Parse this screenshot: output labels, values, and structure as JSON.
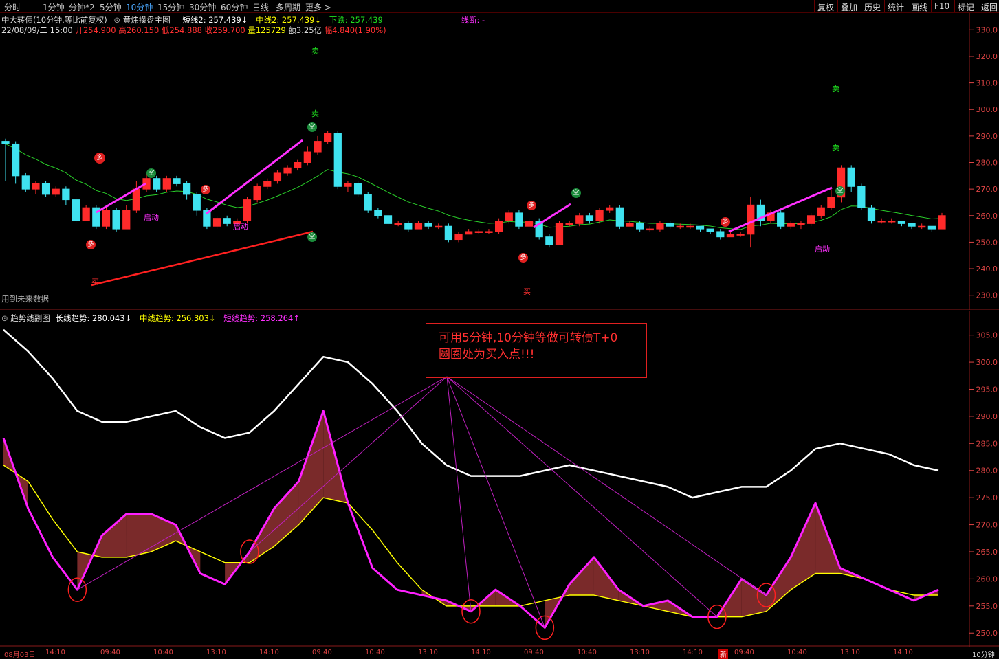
{
  "toolbar": {
    "periods": [
      "分时",
      "1分钟",
      "分钟*2",
      "5分钟",
      "10分钟",
      "15分钟",
      "30分钟",
      "60分钟",
      "日线",
      "多周期",
      "更多 >"
    ],
    "active_period": "10分钟",
    "right_buttons": [
      "复权",
      "叠加",
      "历史",
      "统计",
      "画线",
      "F10",
      "标记",
      "返回"
    ]
  },
  "main_panel": {
    "security": "中大转债(10分钟,等比前复权)",
    "indicator_name": "黄炜操盘主图",
    "short_line": "短线2: 257.439↓",
    "mid_line": "中线2: 257.439↓",
    "down_label": "下跌: 257.439",
    "line_break": "线断: -",
    "date": "22/08/09/二 15:00",
    "open": "开254.900",
    "high": "高260.150",
    "low": "低254.888",
    "close": "收259.700",
    "volume": "量125729",
    "amount": "额3.25亿",
    "range": "幅4.840(1.90%)",
    "future_data_note": "用到未来数据",
    "signals": {
      "sell": "卖",
      "buy": "买",
      "start": "启动",
      "empty": "空",
      "many": "多"
    }
  },
  "sub_panel": {
    "indicator_name": "趋势线副图",
    "long_trend": "长线趋势: 280.043↓",
    "mid_trend": "中线趋势: 256.303↓",
    "short_trend": "短线趋势: 258.264↑"
  },
  "annotation": {
    "line1": "可用5分钟,10分钟等做可转债T+0",
    "line2": "圆圈处为买入点!!!"
  },
  "x_axis": {
    "labels": [
      "08月03日",
      "14:10",
      "09:40",
      "10:40",
      "13:10",
      "14:10",
      "09:40",
      "10:40",
      "13:10",
      "14:10",
      "09:40",
      "10:40",
      "13:10",
      "14:10",
      "09:40",
      "10:40",
      "13:10",
      "14:10"
    ],
    "right_label": "10分钟",
    "new_badge": "新"
  },
  "colors": {
    "up": "#ff2a2a",
    "down": "#3fe2f0",
    "long_trend": "#ffffff",
    "mid_trend": "#ffff00",
    "short_trend": "#ff20ff",
    "axis": "#d44444"
  },
  "chart_data": [
    {
      "type": "candlestick",
      "title": "黄炜操盘主图",
      "ylim": [
        225,
        335
      ],
      "y_ticks": [
        230.0,
        240.0,
        250.0,
        260.0,
        270.0,
        280.0,
        290.0,
        300.0,
        310.0,
        320.0,
        330.0
      ],
      "candles": [
        [
          288,
          287,
          289,
          273
        ],
        [
          287,
          275,
          288,
          272
        ],
        [
          275,
          270,
          276,
          269
        ],
        [
          270,
          272,
          273,
          268
        ],
        [
          272,
          268,
          273,
          267
        ],
        [
          268,
          270,
          271,
          267
        ],
        [
          270,
          266,
          271,
          264
        ],
        [
          266,
          258,
          267,
          257
        ],
        [
          258,
          263,
          264,
          258
        ],
        [
          263,
          256,
          264,
          255
        ],
        [
          256,
          262,
          263,
          255
        ],
        [
          262,
          255,
          263,
          254
        ],
        [
          255,
          262,
          264,
          255
        ],
        [
          262,
          270,
          273,
          261
        ],
        [
          270,
          274,
          276,
          269
        ],
        [
          274,
          270,
          275,
          269
        ],
        [
          270,
          274,
          275,
          269
        ],
        [
          274,
          272,
          275,
          271
        ],
        [
          272,
          268,
          273,
          266
        ],
        [
          268,
          262,
          269,
          260
        ],
        [
          262,
          256,
          263,
          255
        ],
        [
          256,
          259,
          260,
          255
        ],
        [
          259,
          257,
          260,
          256
        ],
        [
          257,
          258,
          259,
          256
        ],
        [
          258,
          266,
          267,
          257
        ],
        [
          266,
          271,
          272,
          265
        ],
        [
          271,
          273,
          274,
          270
        ],
        [
          273,
          276,
          277,
          272
        ],
        [
          276,
          278,
          279,
          275
        ],
        [
          278,
          280,
          281,
          277
        ],
        [
          280,
          284,
          286,
          279
        ],
        [
          284,
          288,
          290,
          283
        ],
        [
          288,
          291,
          292,
          287
        ],
        [
          291,
          271,
          292,
          270
        ],
        [
          271,
          272,
          273,
          269
        ],
        [
          272,
          268,
          273,
          267
        ],
        [
          268,
          262,
          269,
          261
        ],
        [
          262,
          260,
          263,
          259
        ],
        [
          260,
          257,
          261,
          256
        ],
        [
          257,
          257,
          258,
          256
        ],
        [
          257,
          255,
          258,
          254
        ],
        [
          255,
          257,
          258,
          255
        ],
        [
          257,
          256,
          258,
          255
        ],
        [
          256,
          256,
          257,
          255
        ],
        [
          256,
          251,
          257,
          250
        ],
        [
          251,
          253,
          254,
          250
        ],
        [
          253,
          254,
          255,
          253
        ],
        [
          254,
          254,
          255,
          253
        ],
        [
          254,
          254,
          255,
          253
        ],
        [
          254,
          258,
          259,
          253
        ],
        [
          258,
          261,
          262,
          257
        ],
        [
          261,
          256,
          262,
          255
        ],
        [
          256,
          258,
          259,
          256
        ],
        [
          258,
          252,
          259,
          251
        ],
        [
          252,
          249,
          253,
          248
        ],
        [
          249,
          257,
          258,
          249
        ],
        [
          257,
          257,
          258,
          256
        ],
        [
          257,
          260,
          261,
          256
        ],
        [
          260,
          258,
          261,
          257
        ],
        [
          258,
          262,
          263,
          257
        ],
        [
          262,
          263,
          264,
          261
        ],
        [
          263,
          256,
          264,
          255
        ],
        [
          256,
          257,
          258,
          256
        ],
        [
          257,
          255,
          258,
          254
        ],
        [
          255,
          255,
          256,
          254
        ],
        [
          255,
          257,
          258,
          254
        ],
        [
          257,
          256,
          258,
          255
        ],
        [
          256,
          256,
          257,
          255
        ],
        [
          256,
          256,
          257,
          255
        ],
        [
          256,
          255,
          256,
          254
        ],
        [
          255,
          254,
          255,
          253
        ],
        [
          254,
          252,
          255,
          251
        ],
        [
          252,
          253,
          254,
          252
        ],
        [
          253,
          253,
          254,
          252
        ],
        [
          253,
          264,
          267,
          248
        ],
        [
          264,
          258,
          266,
          256
        ],
        [
          258,
          261,
          262,
          257
        ],
        [
          261,
          256,
          262,
          255
        ],
        [
          256,
          257,
          258,
          255
        ],
        [
          257,
          257,
          258,
          255
        ],
        [
          257,
          260,
          261,
          256
        ],
        [
          260,
          263,
          264,
          259
        ],
        [
          263,
          267,
          270,
          262
        ],
        [
          267,
          278,
          279,
          265
        ],
        [
          278,
          271,
          279,
          269
        ],
        [
          271,
          263,
          272,
          262
        ],
        [
          263,
          258,
          264,
          257
        ],
        [
          258,
          258,
          259,
          257
        ],
        [
          258,
          258,
          259,
          257
        ],
        [
          258,
          257,
          258,
          256
        ],
        [
          257,
          256,
          257,
          255
        ],
        [
          256,
          256,
          257,
          255
        ],
        [
          256,
          255,
          256,
          254
        ],
        [
          255,
          260,
          261,
          255
        ]
      ]
    },
    {
      "type": "line",
      "title": "趋势线副图",
      "ylim": [
        248,
        308
      ],
      "y_ticks": [
        250.0,
        255.0,
        260.0,
        265.0,
        270.0,
        275.0,
        280.0,
        285.0,
        290.0,
        295.0,
        300.0,
        305.0
      ],
      "series": [
        {
          "name": "长线趋势",
          "values": [
            306,
            302,
            297,
            291,
            289,
            289,
            290,
            291,
            288,
            286,
            287,
            291,
            296,
            301,
            300,
            296,
            291,
            285,
            281,
            279,
            279,
            279,
            280,
            281,
            280,
            279,
            278,
            277,
            275,
            276,
            277,
            277,
            280,
            284,
            285,
            284,
            283,
            281,
            280
          ]
        },
        {
          "name": "中线趋势",
          "values": [
            281,
            278,
            271,
            265,
            264,
            264,
            265,
            267,
            265,
            263,
            263,
            266,
            270,
            275,
            274,
            269,
            263,
            258,
            255,
            255,
            255,
            255,
            256,
            257,
            257,
            256,
            255,
            254,
            253,
            253,
            253,
            254,
            258,
            261,
            261,
            260,
            258,
            257,
            257
          ]
        },
        {
          "name": "短线趋势",
          "values": [
            286,
            273,
            264,
            258,
            268,
            272,
            272,
            270,
            261,
            259,
            265,
            273,
            278,
            291,
            274,
            262,
            258,
            257,
            256,
            254,
            258,
            255,
            251,
            259,
            264,
            258,
            255,
            256,
            253,
            253,
            260,
            257,
            264,
            274,
            262,
            260,
            258,
            256,
            258
          ]
        }
      ]
    }
  ]
}
